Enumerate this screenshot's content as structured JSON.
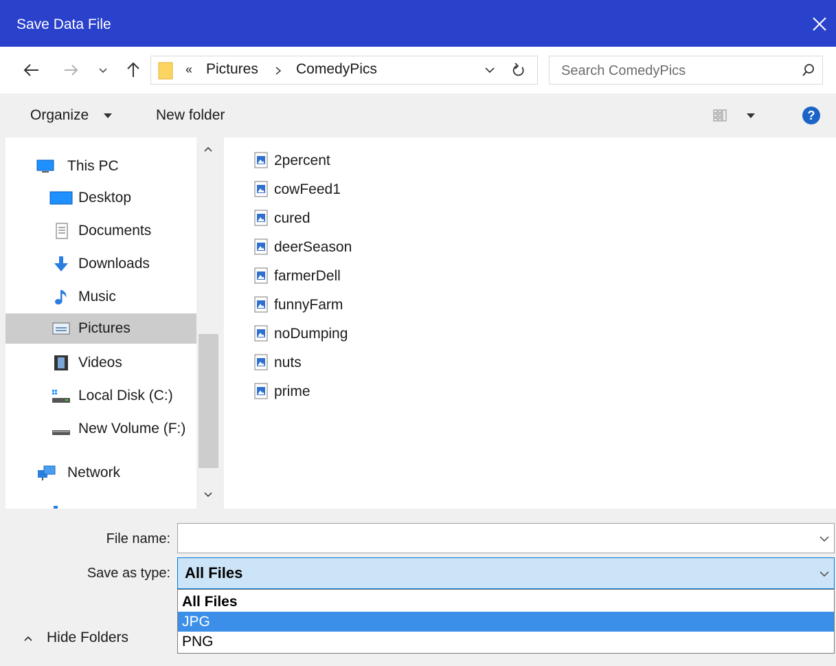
{
  "window": {
    "title": "Save Data File"
  },
  "address": {
    "overflow_marker": "«",
    "crumbs": [
      "Pictures",
      "ComedyPics"
    ],
    "search_placeholder": "Search ComedyPics"
  },
  "toolbar": {
    "organize": "Organize",
    "new_folder": "New folder"
  },
  "nav": {
    "items": [
      {
        "label": "This PC",
        "icon": "computer-icon"
      },
      {
        "label": "Desktop",
        "icon": "desktop-icon"
      },
      {
        "label": "Documents",
        "icon": "documents-icon"
      },
      {
        "label": "Downloads",
        "icon": "downloads-icon"
      },
      {
        "label": "Music",
        "icon": "music-icon"
      },
      {
        "label": "Pictures",
        "icon": "pictures-icon",
        "selected": true
      },
      {
        "label": "Videos",
        "icon": "videos-icon"
      },
      {
        "label": "Local Disk (C:)",
        "icon": "local-disk-icon"
      },
      {
        "label": "New Volume (F:)",
        "icon": "drive-icon"
      },
      {
        "label": "Network",
        "icon": "network-icon"
      }
    ]
  },
  "files": [
    "2percent",
    "cowFeed1",
    "cured",
    "deerSeason",
    "farmerDell",
    "funnyFarm",
    "noDumping",
    "nuts",
    "prime"
  ],
  "form": {
    "file_name_label": "File name:",
    "file_name_value": "",
    "save_as_type_label": "Save as type:",
    "save_as_type_value": "All Files",
    "type_options": [
      "All Files",
      "JPG",
      "PNG"
    ],
    "highlighted_option": "JPG"
  },
  "footer": {
    "hide_folders": "Hide Folders"
  },
  "colors": {
    "titlebar": "#2a41cb",
    "selection": "#cccccc",
    "dropdown_highlight": "#3b8fe8",
    "focus_field": "#cce4f7"
  }
}
